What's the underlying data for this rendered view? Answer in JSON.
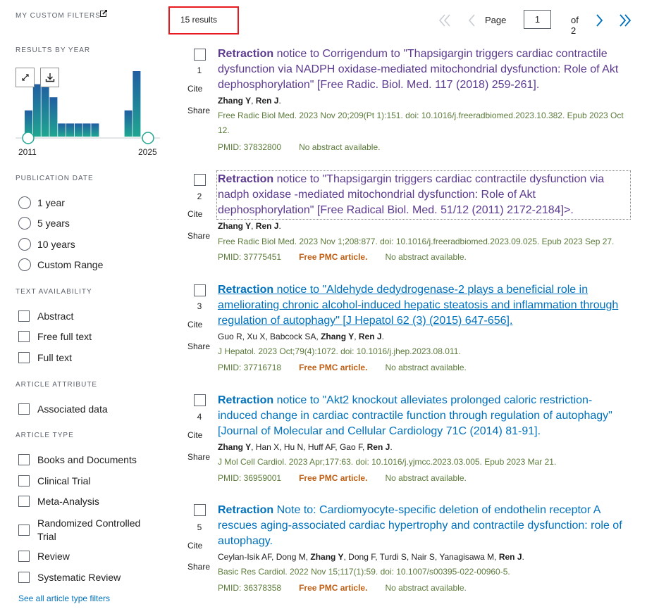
{
  "sidebar": {
    "custom_filters": "MY CUSTOM FILTERS",
    "results_by_year": "RESULTS BY YEAR",
    "year_start": "2011",
    "year_end": "2025",
    "publication_date": {
      "heading": "PUBLICATION DATE",
      "options": [
        "1 year",
        "5 years",
        "10 years",
        "Custom Range"
      ]
    },
    "text_availability": {
      "heading": "TEXT AVAILABILITY",
      "options": [
        "Abstract",
        "Free full text",
        "Full text"
      ]
    },
    "article_attribute": {
      "heading": "ARTICLE ATTRIBUTE",
      "options": [
        "Associated data"
      ]
    },
    "article_type": {
      "heading": "ARTICLE TYPE",
      "options": [
        "Books and Documents",
        "Clinical Trial",
        "Meta-Analysis",
        "Randomized Controlled Trial",
        "Review",
        "Systematic Review"
      ]
    },
    "see_all": "See all article type filters"
  },
  "chart_data": {
    "type": "bar",
    "categories": [
      "2011",
      "2012",
      "2013",
      "2014",
      "2015",
      "2016",
      "2017",
      "2018",
      "2019",
      "2020",
      "2021",
      "2022",
      "2023",
      "2024",
      "2025"
    ],
    "values": [
      2,
      4,
      4,
      3,
      1,
      1,
      1,
      1,
      1,
      0,
      0,
      0,
      2,
      5,
      0
    ],
    "xlabel": "",
    "ylabel": "",
    "colors": {
      "bar": "#20a691",
      "highlight": "#205ea2"
    }
  },
  "results_count": "15 results",
  "pager": {
    "page_label": "Page",
    "page_value": "1",
    "of_label": "of 2"
  },
  "cite_label": "Cite",
  "share_label": "Share",
  "free_pmc_label": "Free PMC article.",
  "no_abstract_label": "No abstract available.",
  "results": [
    {
      "number": "1",
      "keyword": "Retraction",
      "title_rest": " notice to Corrigendum to \"Thapsigargin triggers cardiac contractile dysfunction via NADPH oxidase-mediated mitochondrial dysfunction: Role of Akt dephosphorylation\" [Free Radic. Biol. Med. 117 (2018) 259-261].",
      "authors_html": "<b>Zhang Y</b>, <b>Ren J</b>.",
      "citation": "Free Radic Biol Med. 2023 Nov 20;209(Pt 1):151. doi: 10.1016/j.freeradbiomed.2023.10.382. Epub 2023 Oct 12.",
      "pmid": "PMID: 37832800",
      "free_pmc": false
    },
    {
      "number": "2",
      "keyword": "Retraction",
      "title_rest": " notice to \"Thapsigargin triggers cardiac contractile dysfunction via nadph oxidase -mediated mitochondrial dysfunction: Role of Akt dephosphorylation\" [Free Radical Biol. Med. 51/12 (2011) 2172-2184]>.",
      "authors_html": "<b>Zhang Y</b>, <b>Ren J</b>.",
      "citation": "Free Radic Biol Med. 2023 Nov 1;208:877. doi: 10.1016/j.freeradbiomed.2023.09.025. Epub 2023 Sep 27.",
      "pmid": "PMID: 37775451",
      "free_pmc": true
    },
    {
      "number": "3",
      "keyword": "Retraction",
      "title_rest": " notice to \"Aldehyde dedydrogenase-2 plays a beneficial role in ameliorating chronic alcohol-induced hepatic steatosis and inflammation through regulation of autophagy\" [J Hepatol 62 (3) (2015) 647-656].",
      "authors_html": "Guo R, Xu X, Babcock SA, <b>Zhang Y</b>, <b>Ren J</b>.",
      "citation": "J Hepatol. 2023 Oct;79(4):1072. doi: 10.1016/j.jhep.2023.08.011.",
      "pmid": "PMID: 37716718",
      "free_pmc": true
    },
    {
      "number": "4",
      "keyword": "Retraction",
      "title_rest": " notice to \"Akt2 knockout alleviates prolonged caloric restriction-induced change in cardiac contractile function through regulation of autophagy\" [Journal of Molecular and Cellular Cardiology 71C (2014) 81-91].",
      "authors_html": "<b>Zhang Y</b>, Han X, Hu N, Huff AF, Gao F, <b>Ren J</b>.",
      "citation": "J Mol Cell Cardiol. 2023 Apr;177:63. doi: 10.1016/j.yjmcc.2023.03.005. Epub 2023 Mar 21.",
      "pmid": "PMID: 36959001",
      "free_pmc": true
    },
    {
      "number": "5",
      "keyword": "Retraction",
      "title_rest": " Note to: Cardiomyocyte-specific deletion of endothelin receptor A rescues aging-associated cardiac hypertrophy and contractile dysfunction: role of autophagy.",
      "authors_html": "Ceylan-Isik AF, Dong M, <b>Zhang Y</b>, Dong F, Turdi S, Nair S, Yanagisawa M, <b>Ren J</b>.",
      "citation": "Basic Res Cardiol. 2022 Nov 15;117(1):59. doi: 10.1007/s00395-022-00960-5.",
      "pmid": "PMID: 36378358",
      "free_pmc": true
    }
  ]
}
